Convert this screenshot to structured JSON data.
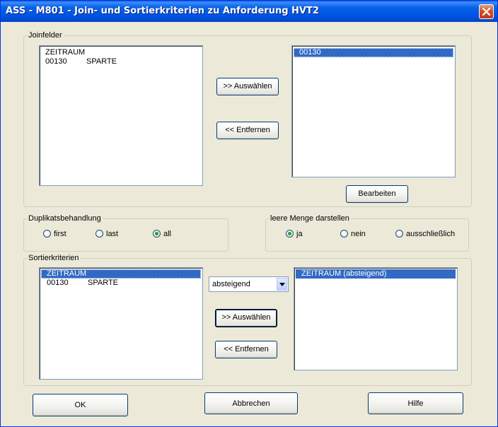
{
  "window": {
    "title": "ASS - M801 - Join- und Sortierkriterien zu Anforderung HVT2"
  },
  "joinfelder": {
    "legend": "Joinfelder",
    "available": [
      {
        "col1": "ZEITRAUM",
        "col2": ""
      },
      {
        "col1": "00130",
        "col2": "SPARTE"
      }
    ],
    "selected": [
      {
        "label": "00130"
      }
    ],
    "btn_select": ">> Auswählen",
    "btn_remove": "<< Entfernen",
    "btn_edit": "Bearbeiten"
  },
  "duplikate": {
    "legend": "Duplikatsbehandlung",
    "options": [
      {
        "label": "first",
        "checked": false
      },
      {
        "label": "last",
        "checked": false
      },
      {
        "label": "all",
        "checked": true
      }
    ]
  },
  "leere_menge": {
    "legend": "leere Menge darstellen",
    "options": [
      {
        "label": "ja",
        "checked": true
      },
      {
        "label": "nein",
        "checked": false
      },
      {
        "label": "ausschließlich",
        "checked": false
      }
    ]
  },
  "sortier": {
    "legend": "Sortierkriterien",
    "available": [
      {
        "col1": "ZEITRAUM",
        "col2": ""
      },
      {
        "col1": "00130",
        "col2": "SPARTE"
      }
    ],
    "order": {
      "value": "absteigend"
    },
    "selected": [
      {
        "label": "ZEITRAUM (absteigend)"
      }
    ],
    "btn_select": ">> Auswählen",
    "btn_remove": "<< Entfernen"
  },
  "footer": {
    "ok": "OK",
    "cancel": "Abbrechen",
    "help": "Hilfe"
  },
  "colors": {
    "titlebar": "#0054E3",
    "selection": "#316AC5",
    "dialog_bg": "#ECE9D8"
  }
}
